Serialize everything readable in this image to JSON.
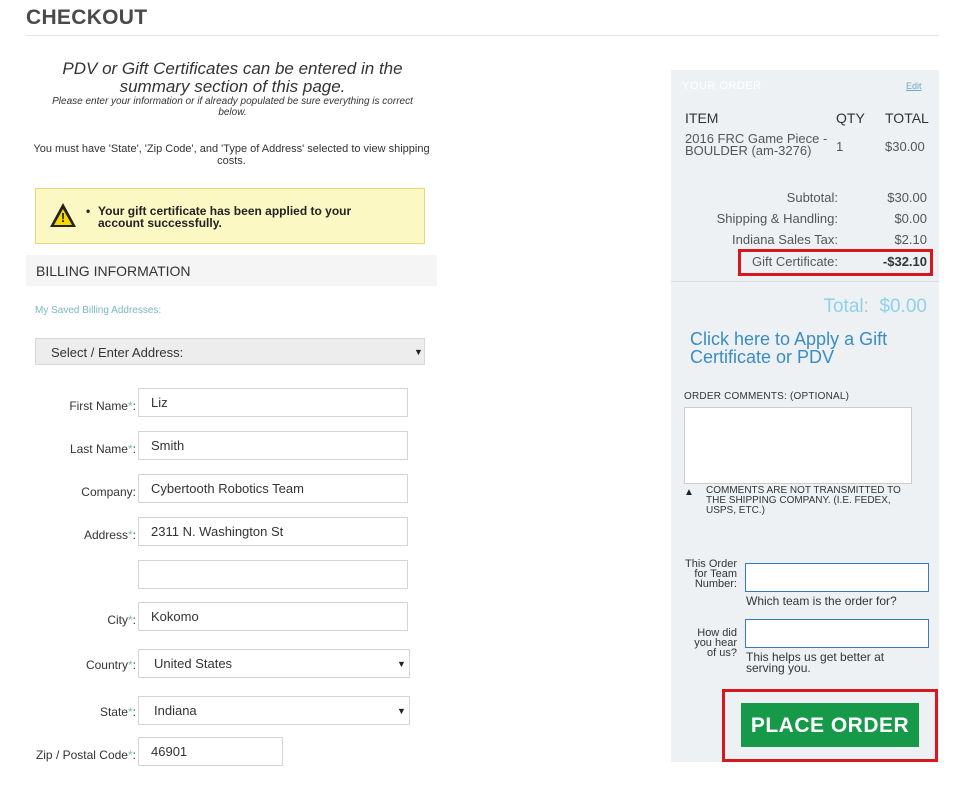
{
  "page": {
    "title": "CHECKOUT"
  },
  "notices": {
    "pdv_heading": "PDV or Gift Certificates can be entered in the summary section of this page.",
    "please_enter": "Please enter your information or if already populated be sure everything is correct below.",
    "must_have": "You must have 'State', 'Zip Code', and 'Type of Address' selected to view shipping costs."
  },
  "alert": {
    "message": "Your gift certificate has been applied to your account successfully."
  },
  "billing": {
    "heading": "BILLING INFORMATION",
    "saved_label": "My Saved Billing Addresses:",
    "address_select": "Select / Enter Address:",
    "required_mark": "*",
    "fields": {
      "first_name": {
        "label": "First Name",
        "value": "Liz"
      },
      "last_name": {
        "label": "Last Name",
        "value": "Smith"
      },
      "company": {
        "label": "Company:",
        "value": "Cybertooth Robotics Team"
      },
      "address": {
        "label": "Address",
        "value": "2311 N. Washington St"
      },
      "address2": {
        "value": ""
      },
      "city": {
        "label": "City",
        "value": "Kokomo"
      },
      "country": {
        "label": "Country",
        "value": "United States"
      },
      "state": {
        "label": "State",
        "value": "Indiana"
      },
      "zip": {
        "label": "Zip / Postal Code",
        "value": "46901"
      }
    }
  },
  "order": {
    "heading": "YOUR ORDER",
    "edit_label": "Edit",
    "columns": {
      "item": "ITEM",
      "qty": "QTY",
      "total": "TOTAL"
    },
    "items": [
      {
        "name": "2016 FRC Game Piece - BOULDER (am-3276)",
        "qty": "1",
        "total": "$30.00"
      }
    ],
    "summary": {
      "subtotal": {
        "label": "Subtotal:",
        "value": "$30.00"
      },
      "shipping": {
        "label": "Shipping & Handling:",
        "value": "$0.00"
      },
      "tax": {
        "label": "Indiana Sales Tax:",
        "value": "$2.10"
      },
      "gift": {
        "label": "Gift Certificate:",
        "value": "-$32.10"
      }
    },
    "total_label": "Total:",
    "total_value": "$0.00",
    "apply_link": "Click here to Apply a Gift Certificate or PDV",
    "comments_label": "ORDER COMMENTS:  (OPTIONAL)",
    "comments_note": "COMMENTS ARE NOT TRANSMITTED TO THE SHIPPING COMPANY. (I.E. FEDEX, USPS, ETC.)",
    "team_label": "This Order for Team Number:",
    "team_help": "Which team is the order for?",
    "hear_label": "How did you hear of us?",
    "hear_help": "This helps us get better at serving you.",
    "place_order": "PLACE ORDER"
  },
  "colors": {
    "accent": "#169a49",
    "highlight": "#d6181f",
    "link": "#3a8cc4",
    "required": "#7ab8bd"
  }
}
